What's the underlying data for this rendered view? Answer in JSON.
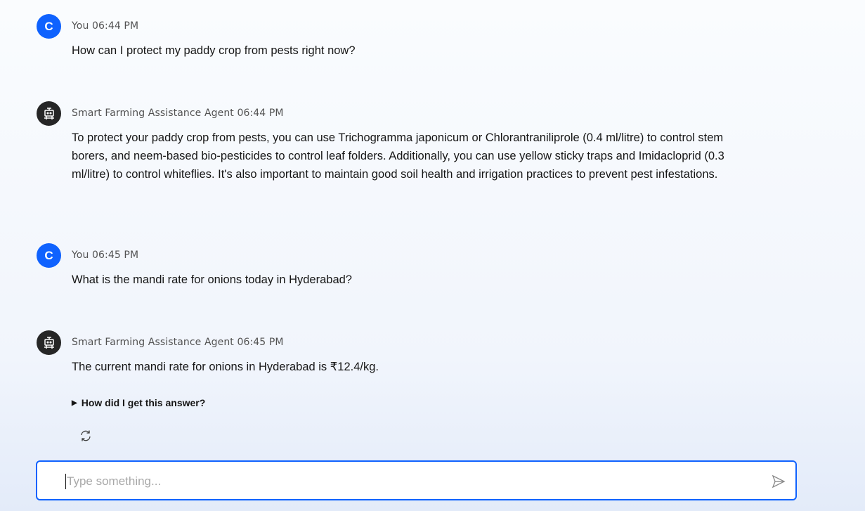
{
  "messages": [
    {
      "avatar": "C",
      "sender": "You",
      "time": "06:44 PM",
      "text": "How can I protect my paddy crop from pests right now?"
    },
    {
      "avatar": "robot-icon",
      "sender": "Smart Farming Assistance Agent",
      "time": "06:44 PM",
      "text": "To protect your paddy crop from pests, you can use Trichogramma japonicum or Chlorantraniliprole (0.4 ml/litre) to control stem borers, and neem-based bio-pesticides to control leaf folders. Additionally, you can use yellow sticky traps and Imidacloprid (0.3 ml/litre) to control whiteflies. It's also important to maintain good soil health and irrigation practices to prevent pest infestations."
    },
    {
      "avatar": "C",
      "sender": "You",
      "time": "06:45 PM",
      "text": "What is the mandi rate for onions today in Hyderabad?"
    },
    {
      "avatar": "robot-icon",
      "sender": "Smart Farming Assistance Agent",
      "time": "06:45 PM",
      "text": "The current mandi rate for onions in Hyderabad is ₹12.4/kg."
    }
  ],
  "details_label": "How did I get this answer?",
  "input": {
    "value": "",
    "placeholder": "Type something..."
  },
  "colors": {
    "accent": "#0f62fe",
    "bot_avatar": "#262626"
  }
}
